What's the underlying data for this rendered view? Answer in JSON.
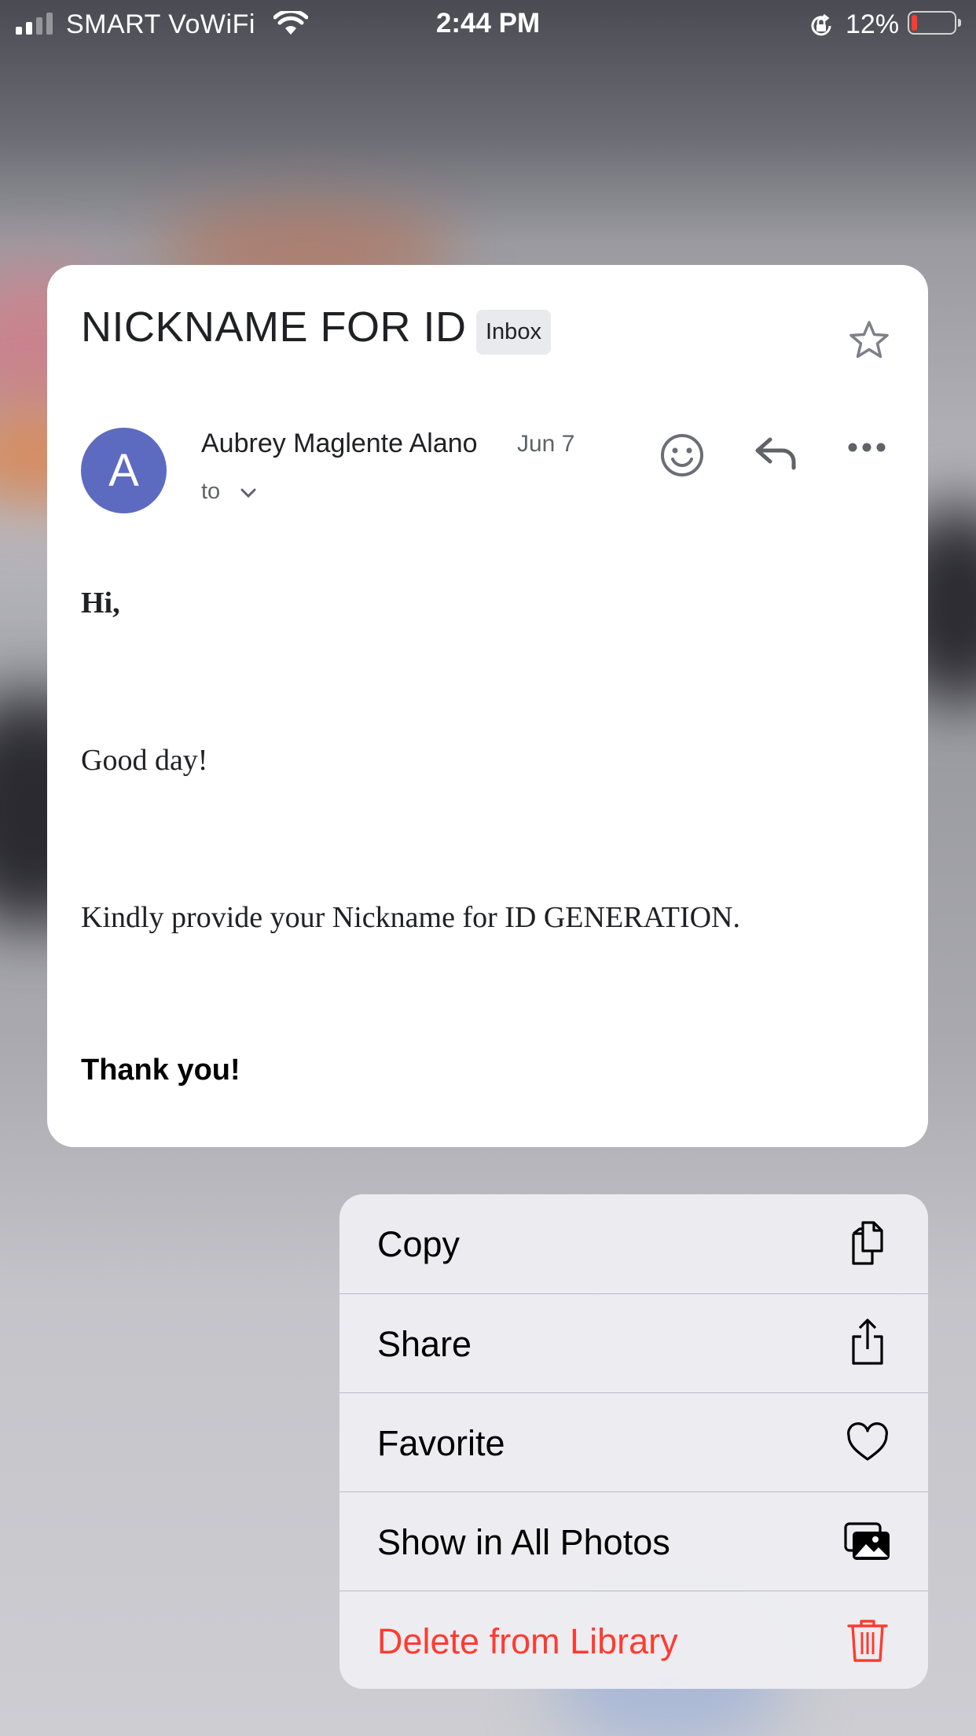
{
  "status_bar": {
    "carrier": "SMART VoWiFi",
    "time": "2:44 PM",
    "battery_percent": "12%",
    "icons": [
      "signal-icon",
      "wifi-icon",
      "orientation-lock-icon",
      "battery-icon"
    ]
  },
  "email": {
    "subject": "NICKNAME FOR ID",
    "label": "Inbox",
    "avatar_letter": "A",
    "sender": "Aubrey Maglente Alano",
    "date": "Jun 7",
    "recipient_prefix": "to",
    "body": {
      "greeting": "Hi,",
      "line1": "Good day!",
      "line2": "Kindly provide your Nickname for ID GENERATION.",
      "closing": "Thank you!"
    },
    "avatar_color": "#5c6bc0"
  },
  "context_menu": {
    "items": [
      {
        "label": "Copy",
        "icon": "copy-icon"
      },
      {
        "label": "Share",
        "icon": "share-icon"
      },
      {
        "label": "Favorite",
        "icon": "heart-icon"
      },
      {
        "label": "Show in All Photos",
        "icon": "photos-icon"
      },
      {
        "label": "Delete from Library",
        "icon": "trash-icon",
        "destructive": true
      }
    ],
    "destructive_color": "#ff3b30"
  }
}
